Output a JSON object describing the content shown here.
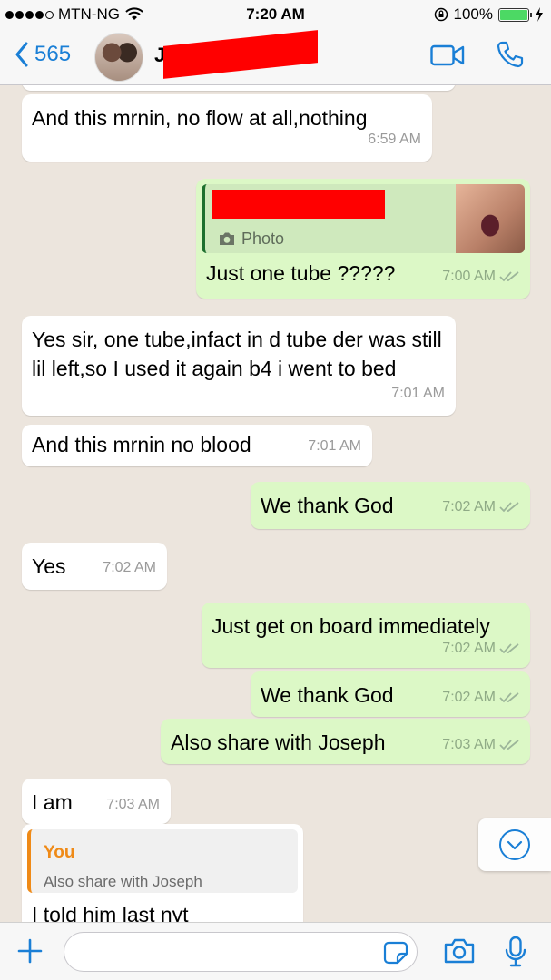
{
  "status_bar": {
    "carrier": "MTN-NG",
    "time": "7:20 AM",
    "battery": "100%",
    "signal_bars": 4,
    "battery_level": 1.0
  },
  "header": {
    "back_count": "565",
    "contact_name_visible": "Jo"
  },
  "messages": [
    {
      "direction": "in",
      "text": "And this mrnin, no flow at all,nothing",
      "time": "6:59 AM"
    },
    {
      "direction": "out",
      "type": "photo-reply",
      "quote_label": "Photo",
      "text": "Just one tube ?????",
      "time": "7:00 AM"
    },
    {
      "direction": "in",
      "text": "Yes sir, one tube,infact in d tube der was still lil left,so I used it again b4 i went to bed",
      "time": "7:01 AM"
    },
    {
      "direction": "in",
      "text": "And this mrnin no blood",
      "time": "7:01 AM"
    },
    {
      "direction": "out",
      "text": "We thank God",
      "time": "7:02 AM"
    },
    {
      "direction": "in",
      "text": "Yes",
      "time": "7:02 AM"
    },
    {
      "direction": "out",
      "text": "Just get on board immediately",
      "time": "7:02 AM"
    },
    {
      "direction": "out",
      "text": "We thank God",
      "time": "7:02 AM"
    },
    {
      "direction": "out",
      "text": "Also share with Joseph",
      "time": "7:03 AM"
    },
    {
      "direction": "in",
      "text": "I am",
      "time": "7:03 AM"
    },
    {
      "direction": "in",
      "type": "reply",
      "reply_author": "You",
      "reply_text": "Also share with Joseph",
      "text": "I told him last nyt"
    }
  ],
  "icons": {
    "back": "chevron-left-icon",
    "video": "video-camera-icon",
    "call": "phone-icon",
    "add": "plus-icon",
    "sticker": "sticker-icon",
    "camera": "camera-icon",
    "mic": "microphone-icon",
    "scroll": "chevron-down-circle-icon"
  },
  "colors": {
    "accent": "#1a7fd6",
    "outgoing_bubble": "#dcf8c6",
    "incoming_bubble": "#ffffff",
    "chat_background": "#ece5dd",
    "reply_author": "#ef8a17",
    "redaction": "#ff0000"
  }
}
